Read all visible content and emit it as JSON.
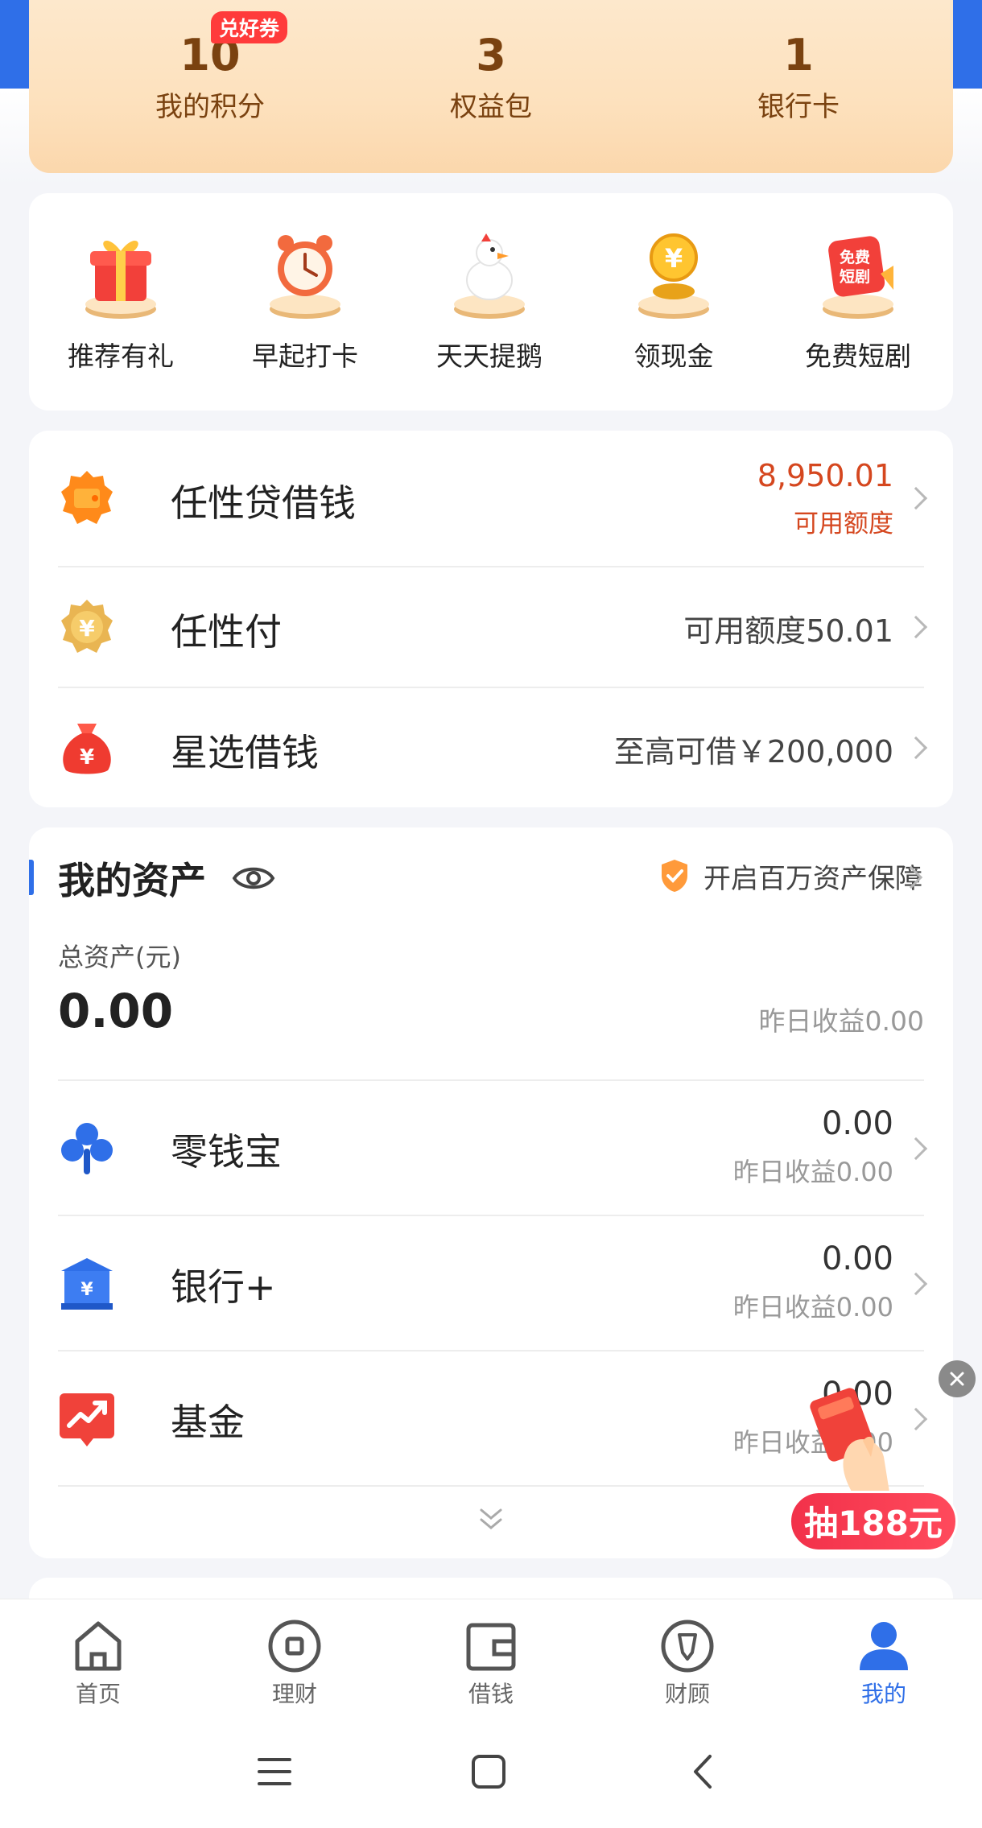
{
  "stats": {
    "points_value": "10",
    "points_label": "我的积分",
    "points_badge": "兑好券",
    "rights_value": "3",
    "rights_label": "权益包",
    "cards_value": "1",
    "cards_label": "银行卡"
  },
  "quick_actions": [
    {
      "label": "推荐有礼",
      "icon": "gift-icon"
    },
    {
      "label": "早起打卡",
      "icon": "alarm-clock-icon"
    },
    {
      "label": "天天提鹅",
      "icon": "goose-icon"
    },
    {
      "label": "领现金",
      "icon": "coin-icon"
    },
    {
      "label": "免费短剧",
      "icon": "short-drama-icon"
    }
  ],
  "loans": [
    {
      "title": "任性贷借钱",
      "value": "8,950.01",
      "sub": "可用额度",
      "icon": "wallet-icon"
    },
    {
      "title": "任性付",
      "value": "可用额度50.01",
      "icon": "yuan-badge-icon"
    },
    {
      "title": "星选借钱",
      "value": "至高可借￥200,000",
      "icon": "money-bag-icon"
    }
  ],
  "assets": {
    "title": "我的资产",
    "protection": "开启百万资产保障",
    "total_label": "总资产(元)",
    "total_value": "0.00",
    "yesterday": "昨日收益0.00",
    "items": [
      {
        "title": "零钱宝",
        "value": "0.00",
        "sub": "昨日收益0.00",
        "icon": "clover-icon"
      },
      {
        "title": "银行+",
        "value": "0.00",
        "sub": "昨日收益0.00",
        "icon": "bank-icon"
      },
      {
        "title": "基金",
        "value": "0.00",
        "sub": "昨日收益0.00",
        "icon": "fund-chart-icon"
      }
    ]
  },
  "promo": {
    "label": "抽188元"
  },
  "tabs": [
    {
      "label": "首页",
      "icon": "home-icon"
    },
    {
      "label": "理财",
      "icon": "finance-icon"
    },
    {
      "label": "借钱",
      "icon": "wallet-tab-icon"
    },
    {
      "label": "财顾",
      "icon": "advisor-icon"
    },
    {
      "label": "我的",
      "icon": "user-icon",
      "active": true
    }
  ],
  "colors": {
    "brand_blue": "#2f6fe8",
    "highlight_red": "#d5471f",
    "stat_brown": "#7a4210"
  }
}
